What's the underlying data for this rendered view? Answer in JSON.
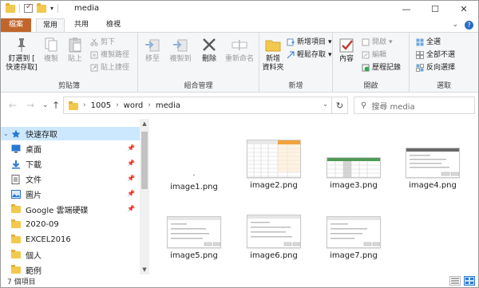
{
  "window": {
    "title": "media",
    "controls": {
      "minimize": "—",
      "maximize": "☐",
      "close": "✕"
    }
  },
  "tabs": {
    "file": "檔案",
    "home": "常用",
    "share": "共用",
    "view": "檢視"
  },
  "ribbon": {
    "clipboard": {
      "label": "剪貼簿",
      "pin_line1": "釘選到 [",
      "pin_line2": "快速存取]",
      "copy": "複製",
      "paste": "貼上",
      "cut": "剪下",
      "copy_path": "複製路徑",
      "paste_shortcut": "貼上捷徑"
    },
    "organize": {
      "label": "組合管理",
      "move_to": "移至",
      "copy_to": "複製到",
      "delete": "刪除",
      "rename": "重新命名"
    },
    "new": {
      "label": "新增",
      "new_folder_line1": "新增",
      "new_folder_line2": "資料夾",
      "new_item": "新增項目",
      "easy_access": "輕鬆存取"
    },
    "open": {
      "label": "開啟",
      "properties": "內容",
      "open": "開啟",
      "edit": "編輯",
      "history": "歷程記錄"
    },
    "select": {
      "label": "選取",
      "select_all": "全選",
      "select_none": "全部不選",
      "invert": "反向選擇"
    }
  },
  "address": {
    "crumbs": [
      "1005",
      "word",
      "media"
    ],
    "search_placeholder": "搜尋 media"
  },
  "nav": {
    "items": [
      {
        "label": "快速存取",
        "icon": "star-icon",
        "pinned": false,
        "selected": true,
        "expand": "⌄"
      },
      {
        "label": "桌面",
        "icon": "desktop-icon",
        "pinned": true
      },
      {
        "label": "下載",
        "icon": "download-icon",
        "pinned": true
      },
      {
        "label": "文件",
        "icon": "document-icon",
        "pinned": true
      },
      {
        "label": "圖片",
        "icon": "pictures-icon",
        "pinned": true
      },
      {
        "label": "Google 雲端硬碟",
        "icon": "google-drive-icon",
        "pinned": true
      },
      {
        "label": "2020-09",
        "icon": "folder-icon",
        "pinned": false
      },
      {
        "label": "EXCEL2016",
        "icon": "folder-icon",
        "pinned": false
      },
      {
        "label": "個人",
        "icon": "folder-icon",
        "pinned": false
      },
      {
        "label": "範例",
        "icon": "folder-icon",
        "pinned": false
      }
    ]
  },
  "files": [
    {
      "name": "image1.png"
    },
    {
      "name": "image2.png"
    },
    {
      "name": "image3.png"
    },
    {
      "name": "image4.png"
    },
    {
      "name": "image5.png"
    },
    {
      "name": "image6.png"
    },
    {
      "name": "image7.png"
    }
  ],
  "status": {
    "count": "7 個項目"
  },
  "colors": {
    "file_tab": "#c0662c",
    "accent": "#2a78d2",
    "selection": "#cce8ff"
  }
}
